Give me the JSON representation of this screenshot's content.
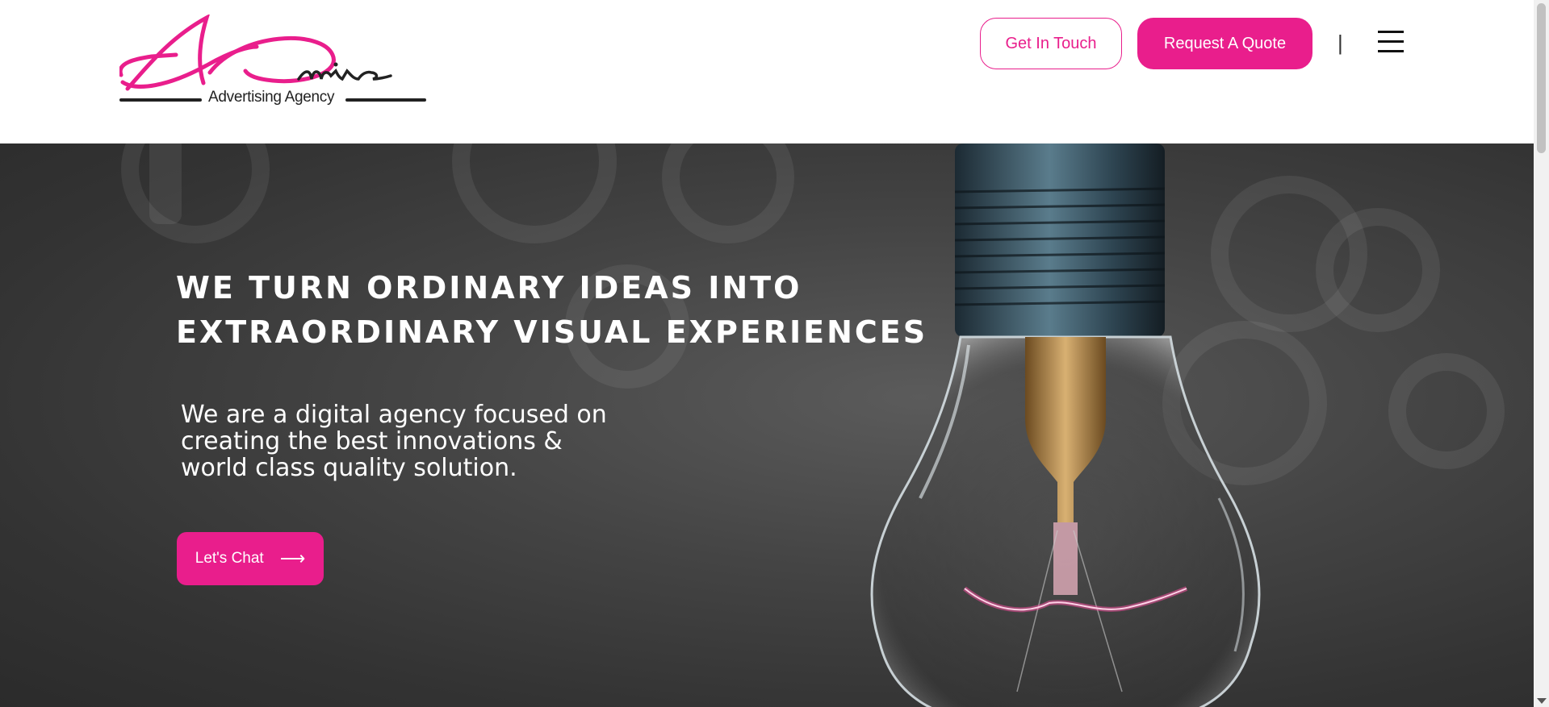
{
  "brand": {
    "name": "ADmire",
    "tagline": "Advertising Agency",
    "color_primary": "#e91e8c",
    "color_dark": "#222222"
  },
  "header": {
    "get_in_touch_label": "Get In Touch",
    "request_quote_label": "Request A Quote",
    "divider": "|",
    "menu_icon": "hamburger-menu-icon"
  },
  "hero": {
    "headline_line1": "WE TURN ORDINARY IDEAS INTO",
    "headline_line2": "EXTRAORDINARY VISUAL EXPERIENCES",
    "subtext": "We are a digital agency focused on creating the best innovations & world class quality solution.",
    "cta_label": "Let's Chat",
    "cta_icon": "arrow-right-icon",
    "background": "light-bulb-photo"
  }
}
